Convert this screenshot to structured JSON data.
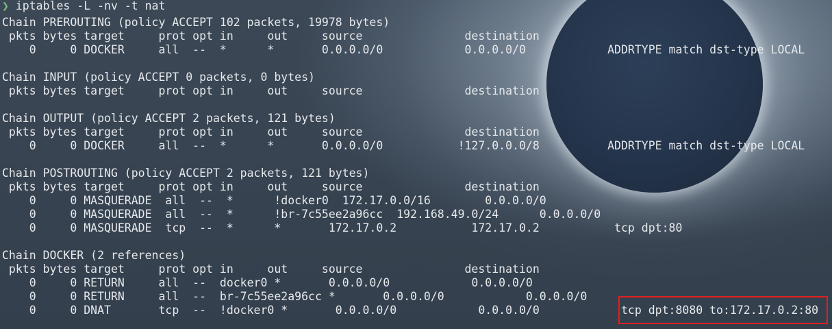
{
  "prompt": {
    "symbol": "❯",
    "command": "iptables -L -nv -t nat"
  },
  "output_lines": [
    "Chain PREROUTING (policy ACCEPT 102 packets, 19978 bytes)",
    " pkts bytes target     prot opt in     out     source               destination",
    "    0     0 DOCKER     all  --  *      *       0.0.0.0/0            0.0.0.0/0            ADDRTYPE match dst-type LOCAL",
    "",
    "Chain INPUT (policy ACCEPT 0 packets, 0 bytes)",
    " pkts bytes target     prot opt in     out     source               destination",
    "",
    "Chain OUTPUT (policy ACCEPT 2 packets, 121 bytes)",
    " pkts bytes target     prot opt in     out     source               destination",
    "    0     0 DOCKER     all  --  *      *       0.0.0.0/0           !127.0.0.0/8          ADDRTYPE match dst-type LOCAL",
    "",
    "Chain POSTROUTING (policy ACCEPT 2 packets, 121 bytes)",
    " pkts bytes target     prot opt in     out     source               destination",
    "    0     0 MASQUERADE  all  --  *      !docker0  172.17.0.0/16        0.0.0.0/0",
    "    0     0 MASQUERADE  all  --  *      !br-7c55ee2a96cc  192.168.49.0/24      0.0.0.0/0",
    "    0     0 MASQUERADE  tcp  --  *      *       172.17.0.2           172.17.0.2           tcp dpt:80",
    "",
    "Chain DOCKER (2 references)",
    " pkts bytes target     prot opt in     out     source               destination",
    "    0     0 RETURN     all  --  docker0 *       0.0.0.0/0            0.0.0.0/0",
    "    0     0 RETURN     all  --  br-7c55ee2a96cc *       0.0.0.0/0            0.0.0.0/0",
    "    0     0 DNAT       tcp  --  !docker0 *       0.0.0.0/0            0.0.0.0/0            tcp dpt:8080 to:172.17.0.2:80"
  ],
  "colors": {
    "prompt_symbol": "#7ec27a",
    "text": "#e6e9ec",
    "highlight_border": "#e01f1f"
  }
}
